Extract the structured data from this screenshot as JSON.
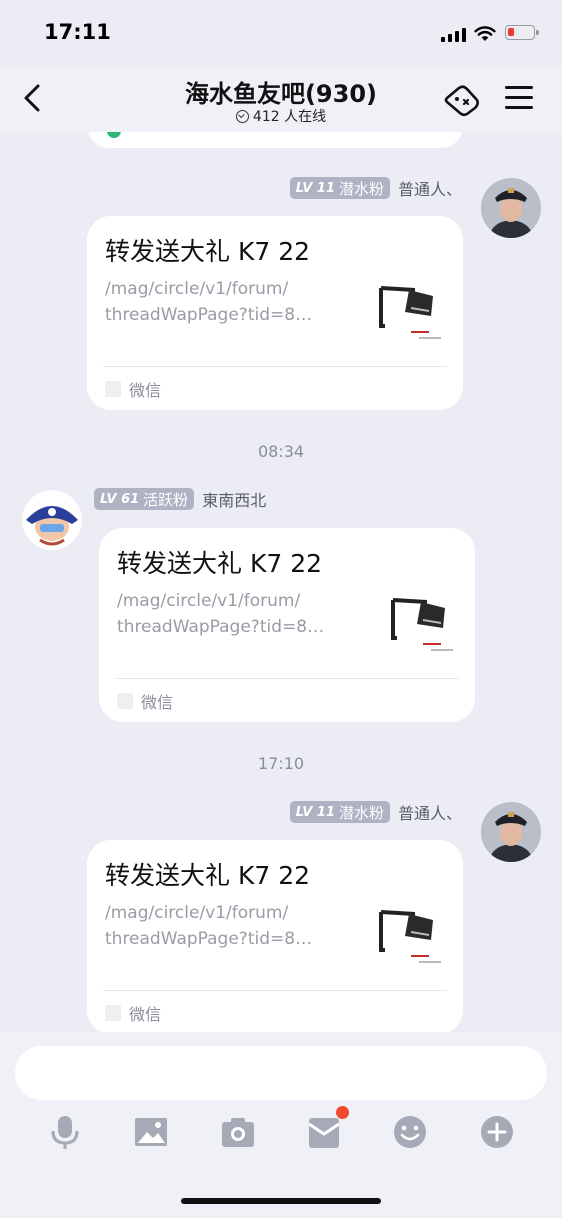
{
  "status_bar": {
    "time": "17:11",
    "battery_color": "#EB3B32"
  },
  "header": {
    "title": "海水鱼友吧(930)",
    "online": "412 人在线"
  },
  "messages": [
    {
      "level": "LV 11",
      "fan_title": "潜水粉",
      "sender": "普通人、",
      "avatar_icon": "person-in-naval-cap",
      "card": {
        "title": "转发送大礼 K7 22",
        "desc": "/mag/circle/v1/forum/\nthreadWapPage?tid=8…",
        "thumb_icon": "aquarium-light-fixture",
        "source": "微信"
      }
    },
    {
      "time": "08:34",
      "level": "LV 61",
      "fan_title": "活跃粉",
      "sender": "東南西北",
      "avatar_icon": "cartoon-pirate-captain",
      "card": {
        "title": "转发送大礼 K7 22",
        "desc": "/mag/circle/v1/forum/\nthreadWapPage?tid=8…",
        "thumb_icon": "aquarium-light-fixture",
        "source": "微信"
      }
    },
    {
      "time": "17:10",
      "level": "LV 11",
      "fan_title": "潜水粉",
      "sender": "普通人、",
      "avatar_icon": "person-in-naval-cap",
      "card": {
        "title": "转发送大礼 K7 22",
        "desc": "/mag/circle/v1/forum/\nthreadWapPage?tid=8…",
        "thumb_icon": "aquarium-light-fixture",
        "source": "微信"
      }
    }
  ],
  "composer": {
    "tools": [
      "microphone-icon",
      "image-icon",
      "camera-icon",
      "red-packet-icon",
      "emoji-icon",
      "plus-icon"
    ],
    "notification_color": "#F04B2F"
  }
}
